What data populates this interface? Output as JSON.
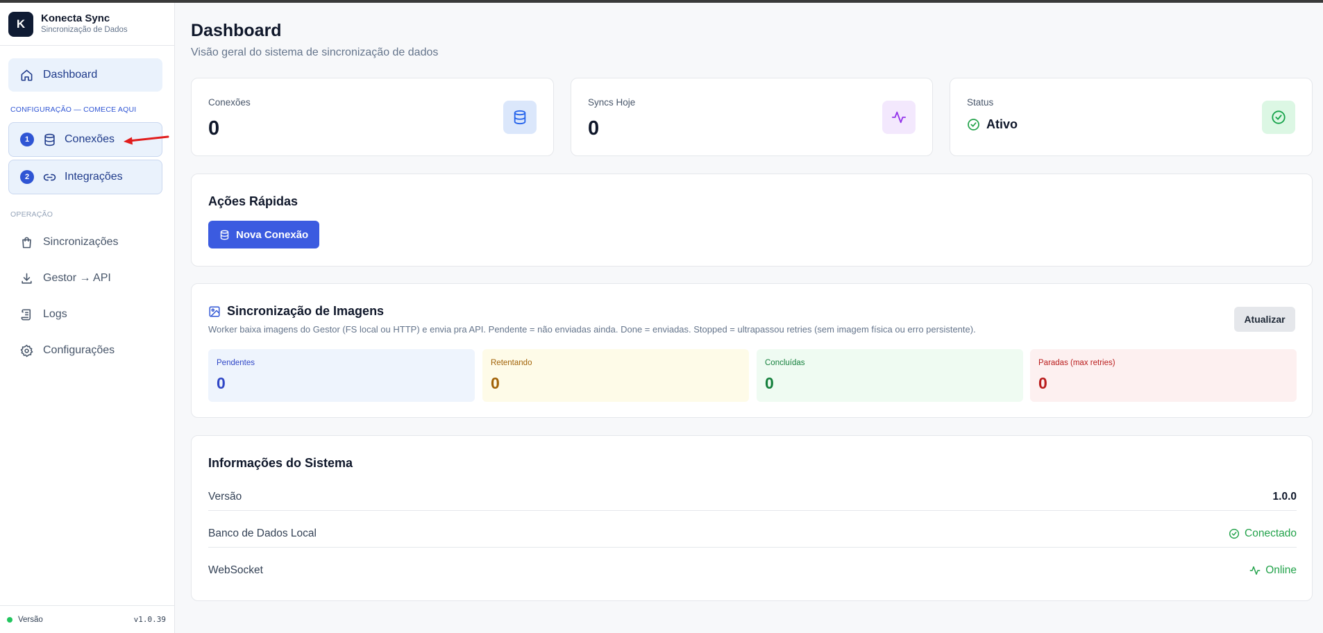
{
  "brand": {
    "logo_letter": "K",
    "title": "Konecta Sync",
    "subtitle": "Sincronização de Dados"
  },
  "sidebar": {
    "dashboard": "Dashboard",
    "config_section": "CONFIGURAÇÃO — COMECE AQUI",
    "config_items": [
      {
        "step": "1",
        "label": "Conexões",
        "icon": "database-icon"
      },
      {
        "step": "2",
        "label": "Integrações",
        "icon": "link-icon"
      }
    ],
    "ops_section": "OPERAÇÃO",
    "ops_items": [
      {
        "label": "Sincronizações",
        "icon": "shopping-bag-icon"
      },
      {
        "label": "Gestor → API",
        "icon": "download-icon"
      },
      {
        "label": "Logs",
        "icon": "scroll-icon"
      },
      {
        "label": "Configurações",
        "icon": "gear-icon"
      }
    ],
    "footer_label": "Versão",
    "footer_version": "v1.0.39"
  },
  "header": {
    "title": "Dashboard",
    "subtitle": "Visão geral do sistema de sincronização de dados"
  },
  "stats": {
    "connections": {
      "label": "Conexões",
      "value": "0"
    },
    "syncs_today": {
      "label": "Syncs Hoje",
      "value": "0"
    },
    "status": {
      "label": "Status",
      "value": "Ativo"
    }
  },
  "quick_actions": {
    "title": "Ações Rápidas",
    "new_connection": "Nova Conexão"
  },
  "image_sync": {
    "title": "Sincronização de Imagens",
    "description": "Worker baixa imagens do Gestor (FS local ou HTTP) e envia pra API. Pendente = não enviadas ainda. Done = enviadas. Stopped = ultrapassou retries (sem imagem física ou erro persistente).",
    "refresh": "Atualizar",
    "metrics": [
      {
        "label": "Pendentes",
        "value": "0"
      },
      {
        "label": "Retentando",
        "value": "0"
      },
      {
        "label": "Concluídas",
        "value": "0"
      },
      {
        "label": "Paradas (max retries)",
        "value": "0"
      }
    ]
  },
  "system_info": {
    "title": "Informações do Sistema",
    "rows": [
      {
        "label": "Versão",
        "value": "1.0.0"
      },
      {
        "label": "Banco de Dados Local",
        "value": "Conectado"
      },
      {
        "label": "WebSocket",
        "value": "Online"
      }
    ]
  },
  "colors": {
    "accent": "#3b5be0",
    "success": "#22a24a",
    "pending_bg": "#eef4fd",
    "pending_fg": "#2f46c6",
    "retry_bg": "#fefbe8",
    "retry_fg": "#a16207",
    "done_bg": "#effbf2",
    "done_fg": "#15803d",
    "stopped_bg": "#fdf0f0",
    "stopped_fg": "#b91c1c"
  }
}
